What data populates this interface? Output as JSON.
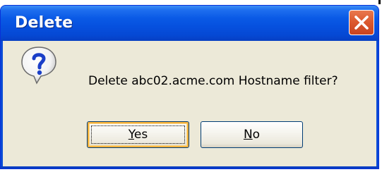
{
  "window": {
    "title": "Delete"
  },
  "dialog": {
    "icon": "question-icon",
    "message": "Delete abc02.acme.com Hostname filter?"
  },
  "buttons": {
    "yes": {
      "mnemonic": "Y",
      "rest": "es"
    },
    "no": {
      "mnemonic": "N",
      "rest": "o"
    }
  },
  "titlebar": {
    "close_icon": "close-x-icon"
  },
  "colors": {
    "titlebar": "#0a5ae6",
    "client_bg": "#ece9d8",
    "close_button": "#dc5a2f",
    "default_button_highlight": "#f8b23c"
  }
}
